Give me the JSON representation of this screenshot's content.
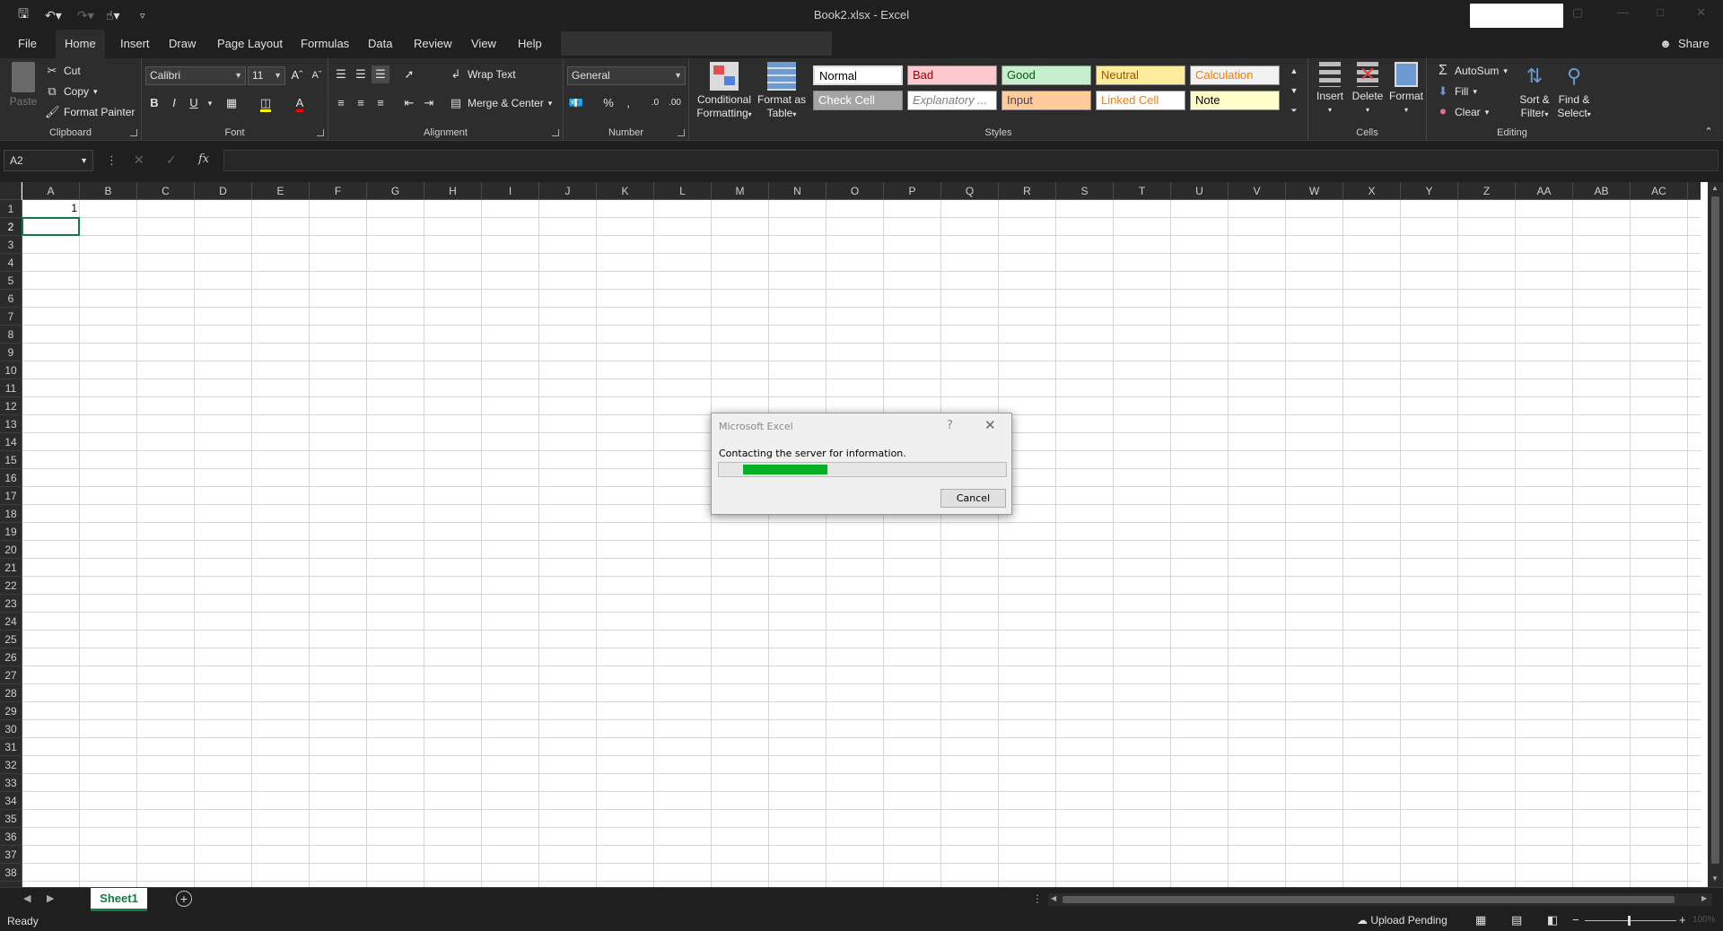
{
  "window": {
    "document_title": "Book2.xlsx  -  Excel"
  },
  "tabs": [
    "File",
    "Home",
    "Insert",
    "Draw",
    "Page Layout",
    "Formulas",
    "Data",
    "Review",
    "View",
    "Help"
  ],
  "active_tab": "Home",
  "share_label": "Share",
  "ribbon": {
    "clipboard": {
      "label": "Clipboard",
      "paste": "Paste",
      "cut": "Cut",
      "copy": "Copy",
      "format_painter": "Format Painter"
    },
    "font": {
      "label": "Font",
      "font_name": "Calibri",
      "font_size": "11"
    },
    "alignment": {
      "label": "Alignment",
      "wrap_text": "Wrap Text",
      "merge_center": "Merge & Center"
    },
    "number": {
      "label": "Number",
      "format": "General"
    },
    "styles": {
      "label": "Styles",
      "conditional_formatting_1": "Conditional",
      "conditional_formatting_2": "Formatting",
      "format_as_table_1": "Format as",
      "format_as_table_2": "Table",
      "gallery": [
        {
          "name": "Normal",
          "bg": "#ffffff",
          "fg": "#000000"
        },
        {
          "name": "Bad",
          "bg": "#ffc7ce",
          "fg": "#9c0006"
        },
        {
          "name": "Good",
          "bg": "#c6efce",
          "fg": "#006100"
        },
        {
          "name": "Neutral",
          "bg": "#ffeb9c",
          "fg": "#9c5700"
        },
        {
          "name": "Calculation",
          "bg": "#f2f2f2",
          "fg": "#fa7d00"
        },
        {
          "name": "Check Cell",
          "bg": "#a5a5a5",
          "fg": "#ffffff"
        },
        {
          "name": "Explanatory ...",
          "bg": "#ffffff",
          "fg": "#7f7f7f"
        },
        {
          "name": "Input",
          "bg": "#ffcc99",
          "fg": "#3f3f76"
        },
        {
          "name": "Linked Cell",
          "bg": "#ffffff",
          "fg": "#fa7d00"
        },
        {
          "name": "Note",
          "bg": "#ffffcc",
          "fg": "#000000"
        }
      ]
    },
    "cells": {
      "label": "Cells",
      "insert": "Insert",
      "delete": "Delete",
      "format": "Format"
    },
    "editing": {
      "label": "Editing",
      "autosum": "AutoSum",
      "fill": "Fill",
      "clear": "Clear",
      "sort_filter_1": "Sort &",
      "sort_filter_2": "Filter",
      "find_select_1": "Find &",
      "find_select_2": "Select"
    }
  },
  "formula_bar": {
    "name_box": "A2",
    "fx": "fx",
    "content": ""
  },
  "grid": {
    "columns": [
      "A",
      "B",
      "C",
      "D",
      "E",
      "F",
      "G",
      "H",
      "I",
      "J",
      "K",
      "L",
      "M",
      "N",
      "O",
      "P",
      "Q",
      "R",
      "S",
      "T",
      "U",
      "V",
      "W",
      "X",
      "Y",
      "Z",
      "AA",
      "AB",
      "AC"
    ],
    "rows": [
      1,
      2,
      3,
      4,
      5,
      6,
      7,
      8,
      9,
      10,
      11,
      12,
      13,
      14,
      15,
      16,
      17,
      18,
      19,
      20,
      21,
      22,
      23,
      24,
      25,
      26,
      27,
      28,
      29,
      30,
      31,
      32,
      33,
      34,
      35,
      36,
      37,
      38
    ],
    "cells": [
      {
        "ref": "A1",
        "value": "1"
      }
    ]
  },
  "sheets": [
    "Sheet1"
  ],
  "active_sheet": "Sheet1",
  "status": {
    "ready": "Ready",
    "upload": "Upload Pending",
    "zoom": "100%"
  },
  "dialog": {
    "title": "Microsoft Excel",
    "help": "?",
    "message": "Contacting the server for information.",
    "progress": 0.25,
    "progress_color": "#06b025",
    "cancel": "Cancel"
  }
}
